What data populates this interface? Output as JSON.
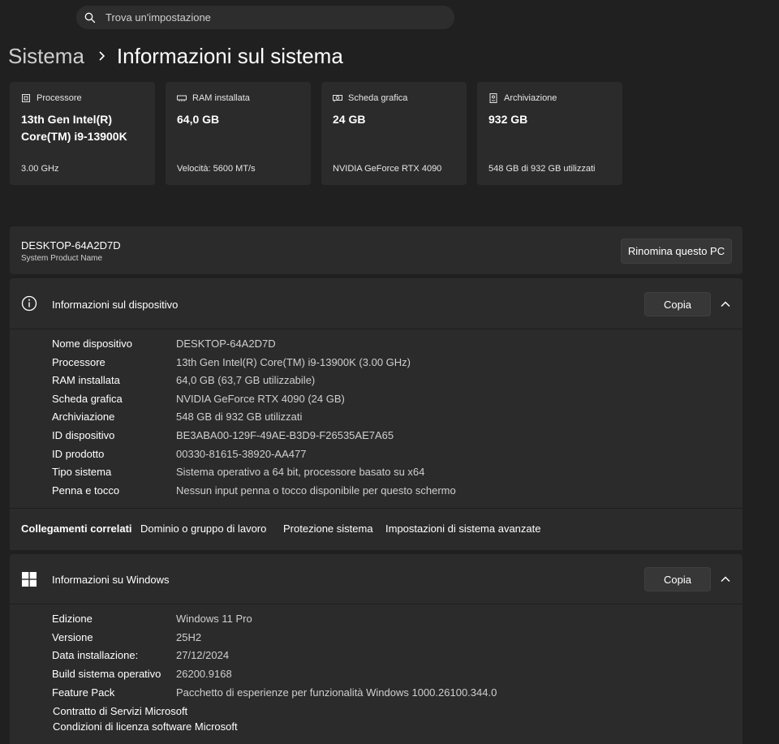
{
  "search": {
    "placeholder": "Trova un'impostazione"
  },
  "breadcrumb": {
    "root": "Sistema",
    "current": "Informazioni sul sistema"
  },
  "specs": [
    {
      "label": "Processore",
      "value": "13th Gen Intel(R) Core(TM) i9-13900K",
      "sub": "3.00 GHz",
      "icon": "cpu-icon"
    },
    {
      "label": "RAM installata",
      "value": "64,0 GB",
      "sub": "Velocità: 5600 MT/s",
      "icon": "ram-icon"
    },
    {
      "label": "Scheda grafica",
      "value": "24 GB",
      "sub": "NVIDIA GeForce RTX 4090",
      "icon": "gpu-icon"
    },
    {
      "label": "Archiviazione",
      "value": "932 GB",
      "sub": "548 GB di 932 GB utilizzati",
      "icon": "storage-icon"
    }
  ],
  "device": {
    "name": "DESKTOP-64A2D7D",
    "product": "System Product Name",
    "rename_label": "Rinomina questo PC"
  },
  "device_info": {
    "title": "Informazioni sul dispositivo",
    "copy_label": "Copia",
    "rows": [
      {
        "k": "Nome dispositivo",
        "v": "DESKTOP-64A2D7D"
      },
      {
        "k": "Processore",
        "v": "13th Gen Intel(R) Core(TM) i9-13900K (3.00 GHz)"
      },
      {
        "k": "RAM installata",
        "v": "64,0 GB (63,7 GB utilizzabile)"
      },
      {
        "k": "Scheda grafica",
        "v": "NVIDIA GeForce RTX 4090 (24 GB)"
      },
      {
        "k": "Archiviazione",
        "v": "548 GB di 932 GB utilizzati"
      },
      {
        "k": "ID dispositivo",
        "v": "BE3ABA00-129F-49AE-B3D9-F26535AE7A65"
      },
      {
        "k": "ID prodotto",
        "v": "00330-81615-38920-AA477"
      },
      {
        "k": "Tipo sistema",
        "v": "Sistema operativo a 64 bit, processore basato su x64"
      },
      {
        "k": "Penna e tocco",
        "v": "Nessun input penna o tocco disponibile per questo schermo"
      }
    ]
  },
  "related": {
    "label": "Collegamenti correlati",
    "links": [
      "Dominio o gruppo di lavoro",
      "Protezione sistema",
      "Impostazioni di sistema avanzate"
    ]
  },
  "windows_info": {
    "title": "Informazioni su Windows",
    "copy_label": "Copia",
    "rows": [
      {
        "k": "Edizione",
        "v": "Windows 11 Pro"
      },
      {
        "k": "Versione",
        "v": "25H2"
      },
      {
        "k": "Data installazione:",
        "v": "27/12/2024"
      },
      {
        "k": "Build sistema operativo",
        "v": "26200.9168"
      },
      {
        "k": "Feature Pack",
        "v": "Pacchetto di esperienze per funzionalità Windows 1000.26100.344.0"
      }
    ],
    "links": [
      "Contratto di Servizi Microsoft",
      "Condizioni di licenza software Microsoft"
    ]
  }
}
